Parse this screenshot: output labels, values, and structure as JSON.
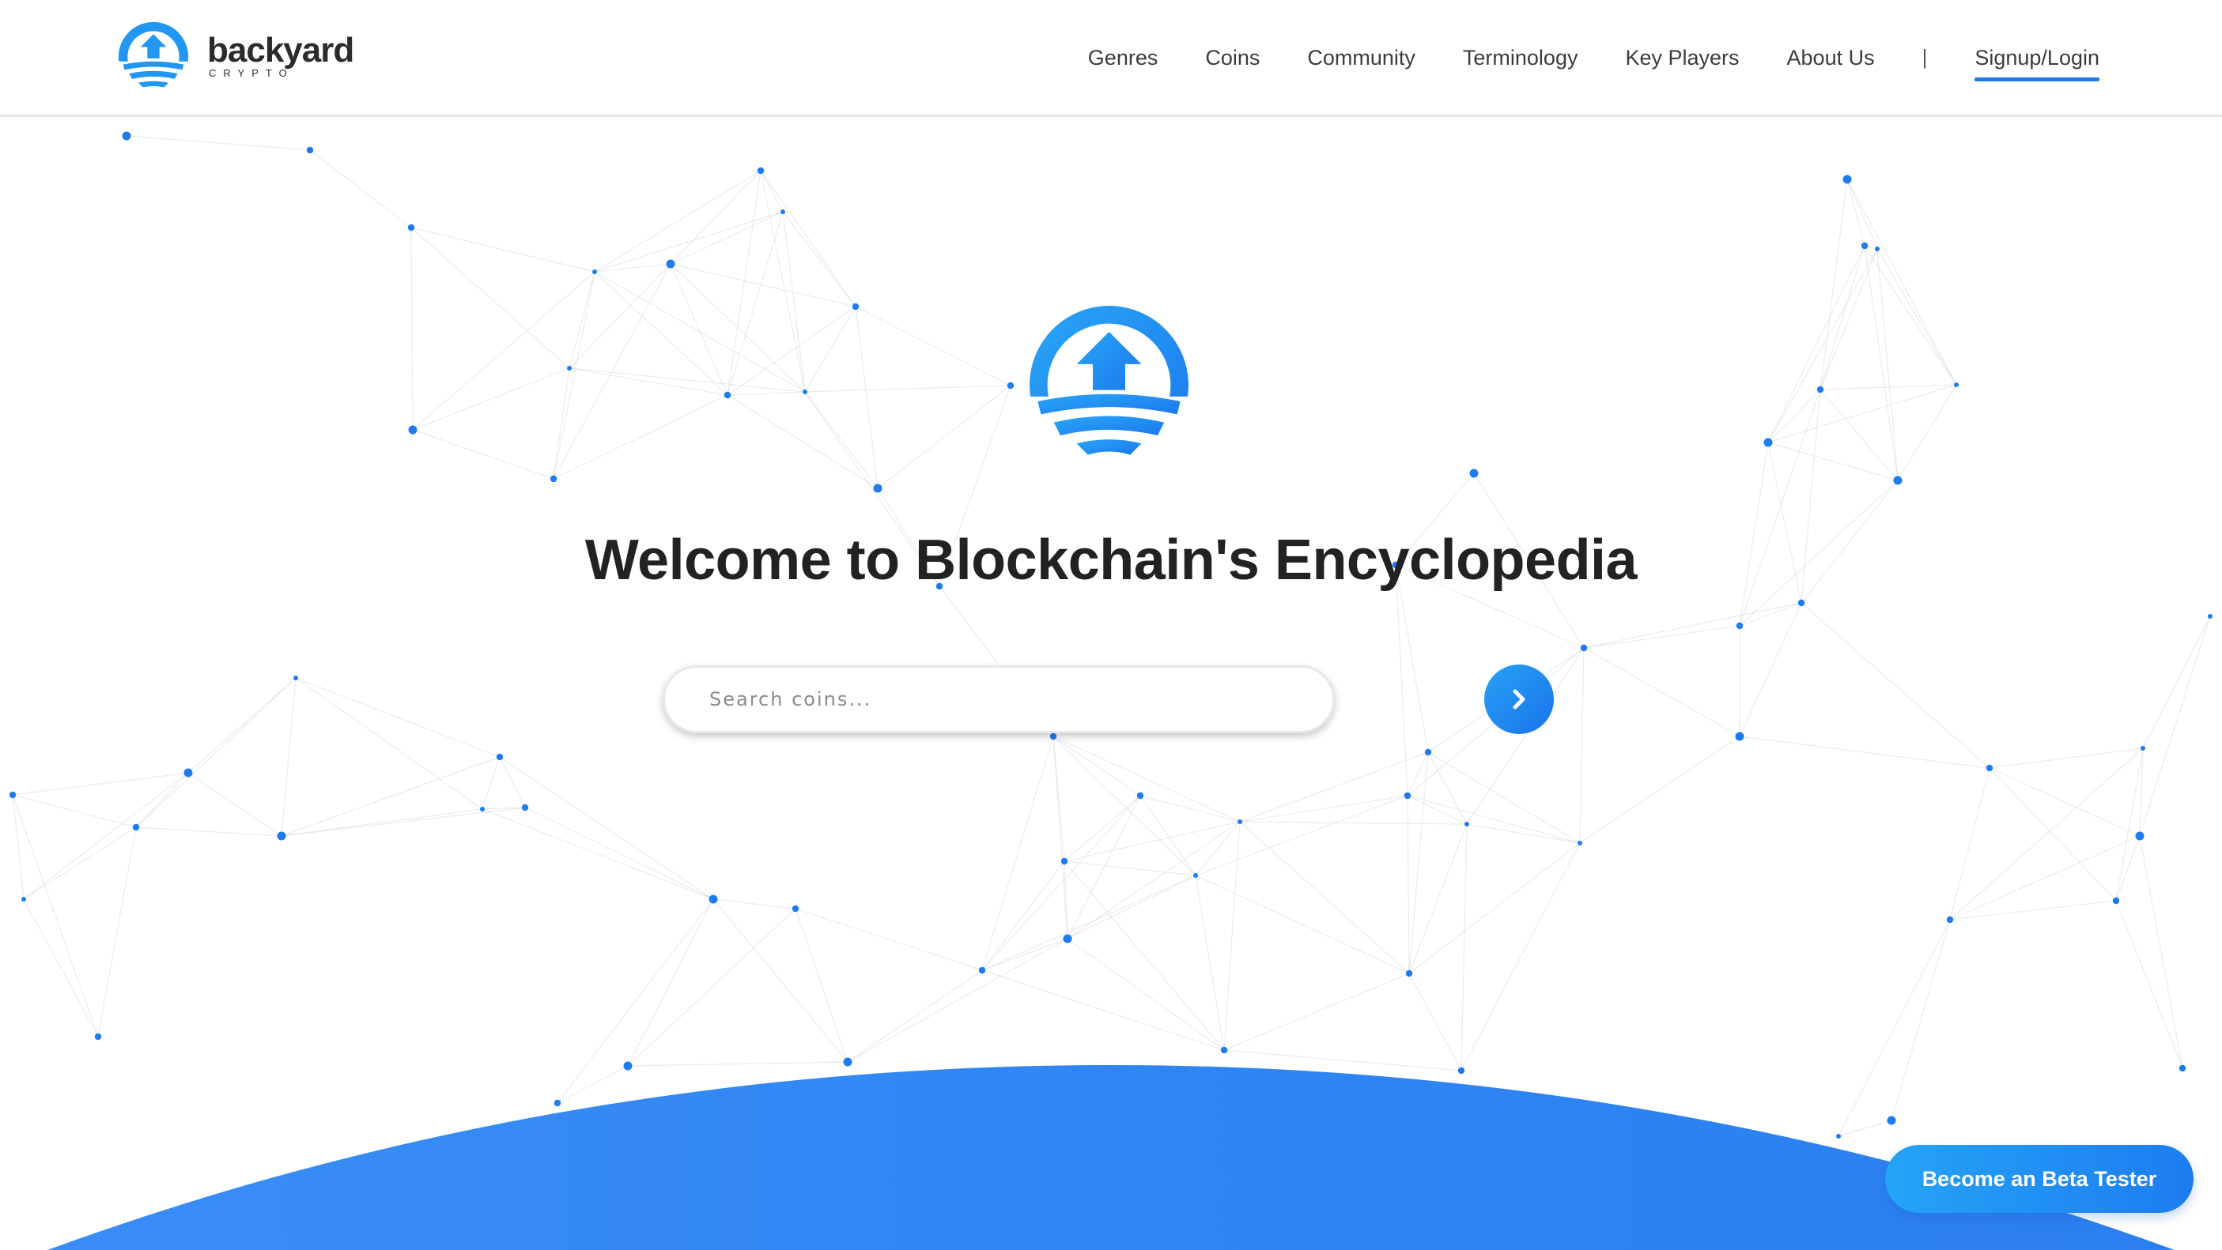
{
  "brand": {
    "name": "backyard",
    "sub": "CRYPTO"
  },
  "nav": {
    "items": [
      "Genres",
      "Coins",
      "Community",
      "Terminology",
      "Key Players",
      "About Us"
    ],
    "separator": "|",
    "login": "Signup/Login"
  },
  "hero": {
    "title": "Welcome to Blockchain's Encyclopedia"
  },
  "search": {
    "placeholder": "Search coins...",
    "value": ""
  },
  "cta": {
    "beta_label": "Become an Beta Tester"
  },
  "colors": {
    "accent": "#1e7cf0",
    "accent_light": "#27a2f6",
    "title_text": "#222222",
    "nav_text": "#3c3c3c"
  },
  "icons": {
    "brand_logo": "backyard-logo-icon",
    "hero_logo": "backyard-logo-icon",
    "search_submit": "chevron-right-icon"
  }
}
